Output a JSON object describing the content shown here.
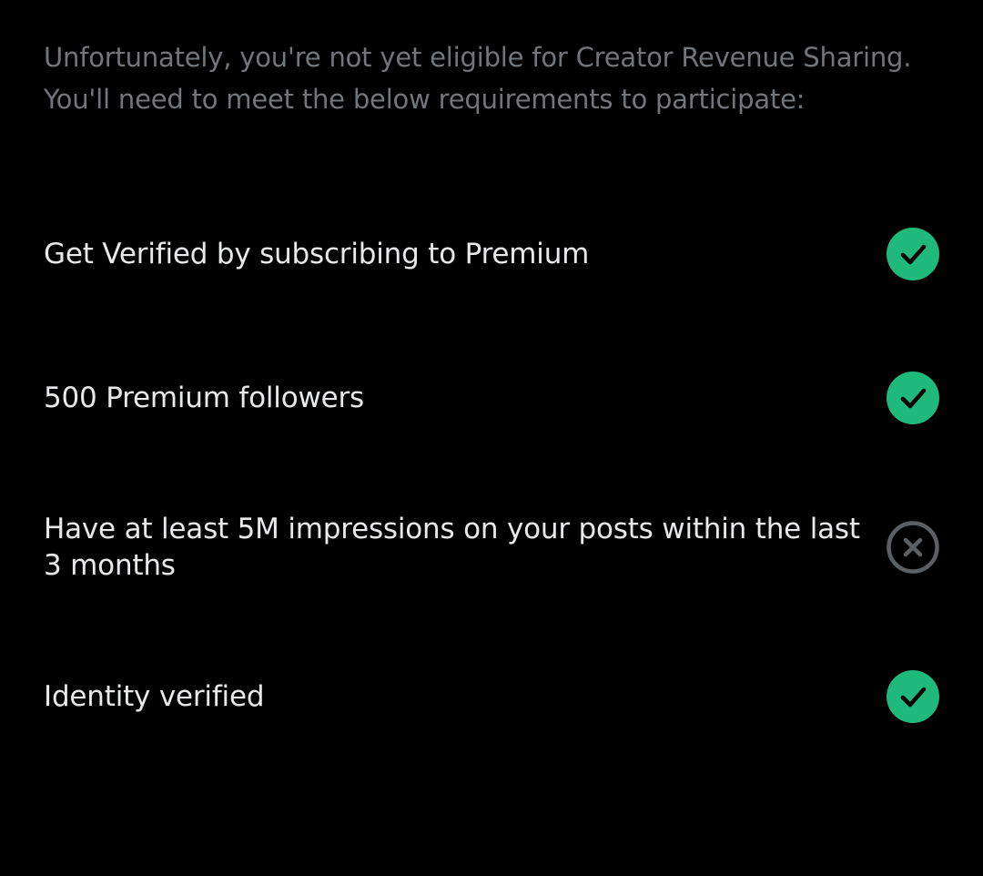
{
  "intro": {
    "line1": "Unfortunately, you're not yet eligible for Creator Revenue Sharing.",
    "line2": "You'll need to meet the below requirements to participate:"
  },
  "requirements": [
    {
      "label": "Get Verified by subscribing to Premium",
      "met": true,
      "icon": "check-circle-icon"
    },
    {
      "label": "500 Premium followers",
      "met": true,
      "icon": "check-circle-icon"
    },
    {
      "label": "Have at least 5M impressions on your posts within the last 3 months",
      "met": false,
      "icon": "x-circle-icon"
    },
    {
      "label": "Identity verified",
      "met": true,
      "icon": "check-circle-icon"
    }
  ],
  "colors": {
    "background": "#000000",
    "text_primary": "#e7e9ea",
    "text_secondary": "#71767b",
    "met": "#1fb97c",
    "unmet": "#5b6064"
  }
}
